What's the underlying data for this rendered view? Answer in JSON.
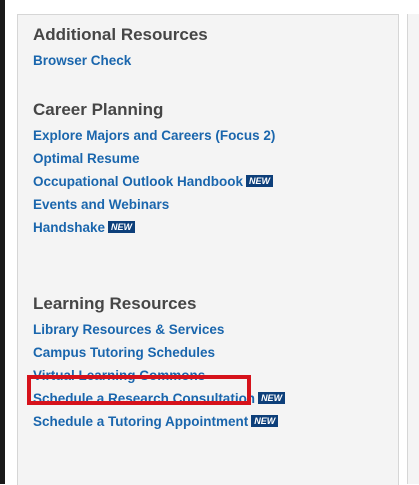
{
  "sections": [
    {
      "heading": "Additional Resources",
      "links": [
        {
          "label": "Browser Check"
        }
      ]
    },
    {
      "heading": "Career Planning",
      "links": [
        {
          "label": "Explore Majors and Careers (Focus 2)"
        },
        {
          "label": "Optimal Resume"
        },
        {
          "label": "Occupational Outlook Handbook",
          "badge": "NEW"
        },
        {
          "label": "Events and Webinars"
        },
        {
          "label": "Handshake",
          "badge": "NEW"
        }
      ]
    },
    {
      "heading": "Learning Resources",
      "links": [
        {
          "label": "Library Resources & Services"
        },
        {
          "label": "Campus Tutoring Schedules"
        },
        {
          "label": "Virtual Learning Commons",
          "highlighted": true
        },
        {
          "label": "Schedule a Research Consultation",
          "badge": "NEW"
        },
        {
          "label": "Schedule a Tutoring Appointment",
          "badge": "NEW"
        }
      ]
    }
  ],
  "colors": {
    "link": "#1a66ad",
    "heading": "#464646",
    "badge_bg": "#0d3f7a",
    "highlight_border": "#d6121b",
    "panel_bg": "#f4f4f4"
  }
}
